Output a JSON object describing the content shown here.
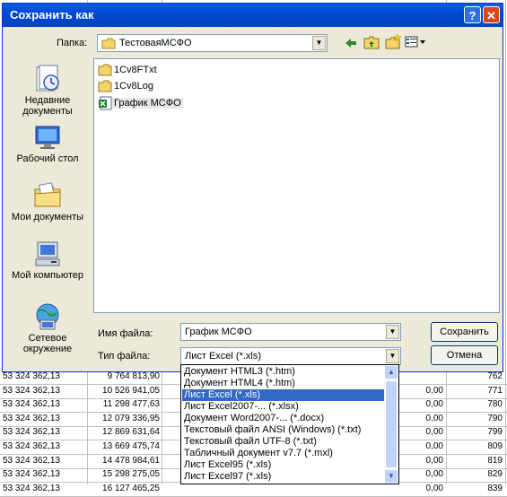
{
  "dialog": {
    "title": "Сохранить как",
    "help_icon": "?",
    "close_icon": "✕",
    "folder_label": "Папка:",
    "folder_value": "ТестоваяМСФО",
    "toolbar_icons": [
      "back-arrow-icon",
      "up-folder-icon",
      "new-folder-icon",
      "view-menu-icon"
    ],
    "places": [
      {
        "label": "Недавние документы",
        "icon": "recent-documents-icon"
      },
      {
        "label": "Рабочий стол",
        "icon": "desktop-icon"
      },
      {
        "label": "Мои документы",
        "icon": "my-documents-icon"
      },
      {
        "label": "Мой компьютер",
        "icon": "my-computer-icon"
      },
      {
        "label": "Сетевое окружение",
        "icon": "network-icon"
      }
    ],
    "files": [
      {
        "name": "1Cv8FTxt",
        "icon": "folder-icon"
      },
      {
        "name": "1Cv8Log",
        "icon": "folder-icon"
      },
      {
        "name": "График МСФО",
        "icon": "excel-file-icon"
      }
    ],
    "filename_label": "Имя файла:",
    "filename_value": "График МСФО",
    "filetype_label": "Тип файла:",
    "filetype_value": "Лист Excel (*.xls)",
    "save_button": "Сохранить",
    "cancel_button": "Отмена"
  },
  "filetype_options": [
    "Документ HTML3 (*.htm)",
    "Документ HTML4 (*.htm)",
    "Лист Excel (*.xls)",
    "Лист Excel2007-... (*.xlsx)",
    "Документ Word2007-... (*.docx)",
    "Текстовый файл ANSI (Windows) (*.txt)",
    "Текстовый файл UTF-8 (*.txt)",
    "Табличный документ v7.7 (*.mxl)",
    "Лист Excel95 (*.xls)",
    "Лист Excel97 (*.xls)"
  ],
  "selected_option_index": 2,
  "spreadsheet_rows": [
    {
      "a": "53 324 362,13",
      "b": "9 764 813,90",
      "c": "",
      "d": "762"
    },
    {
      "a": "53 324 362,13",
      "b": "10 526 941,05",
      "c": "0,00",
      "d": "771"
    },
    {
      "a": "53 324 362,13",
      "b": "11 298 477,63",
      "c": "0,00",
      "d": "780"
    },
    {
      "a": "53 324 362,13",
      "b": "12 079 336,95",
      "c": "0,00",
      "d": "790"
    },
    {
      "a": "53 324 362,13",
      "b": "12 869 631,64",
      "c": "0,00",
      "d": "799"
    },
    {
      "a": "53 324 362,13",
      "b": "13 669 475,74",
      "c": "0,00",
      "d": "809"
    },
    {
      "a": "53 324 362,13",
      "b": "14 478 984,61",
      "c": "0,00",
      "d": "819"
    },
    {
      "a": "53 324 362,13",
      "b": "15 298 275,05",
      "c": "0,00",
      "d": "829"
    },
    {
      "a": "53 324 362,13",
      "b": "16 127 465,25",
      "c": "0,00",
      "d": "839"
    }
  ]
}
